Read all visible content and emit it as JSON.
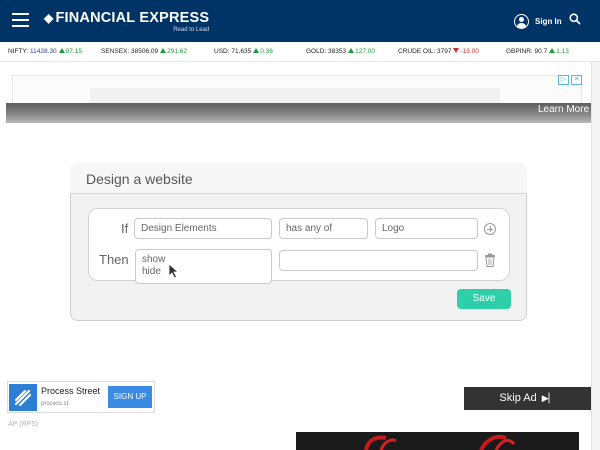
{
  "header": {
    "brand_name": "FINANCIAL EXPRESS",
    "brand_tagline": "Read to Lead",
    "signin_label": "Sign In",
    "bg_color": "#003366"
  },
  "ticker": [
    {
      "label": "NIFTY:",
      "value": "11428.30",
      "dir": "up",
      "change": "87.15"
    },
    {
      "label": "SENSEX:",
      "value": "38506.09",
      "dir": "up",
      "change": "291.62"
    },
    {
      "label": "USD:",
      "value": "71.635",
      "dir": "up",
      "change": "0.36"
    },
    {
      "label": "GOLD:",
      "value": "38353",
      "dir": "up",
      "change": "127.00"
    },
    {
      "label": "CRUDE OIL:",
      "value": "3797",
      "dir": "down",
      "change": "-19.00"
    },
    {
      "label": "GBPINR:",
      "value": "90.7",
      "dir": "up",
      "change": "1.13"
    }
  ],
  "video_ad": {
    "learn_more": "Learn More",
    "card_title": "Design a website",
    "if_label": "If",
    "then_label": "Then",
    "if_field_1": "Design Elements",
    "if_field_2": "has any of",
    "if_field_3": "Logo",
    "then_option_1": "show",
    "then_option_2": "hide",
    "then_field_2": "",
    "save_label": "Save",
    "skip_ad": "Skip Ad",
    "accent_color": "#2ecfa9"
  },
  "bottom_ad": {
    "name": "Process Street",
    "url": "process.st",
    "cta": "SIGN UP"
  },
  "caption": "AP (RPS)"
}
